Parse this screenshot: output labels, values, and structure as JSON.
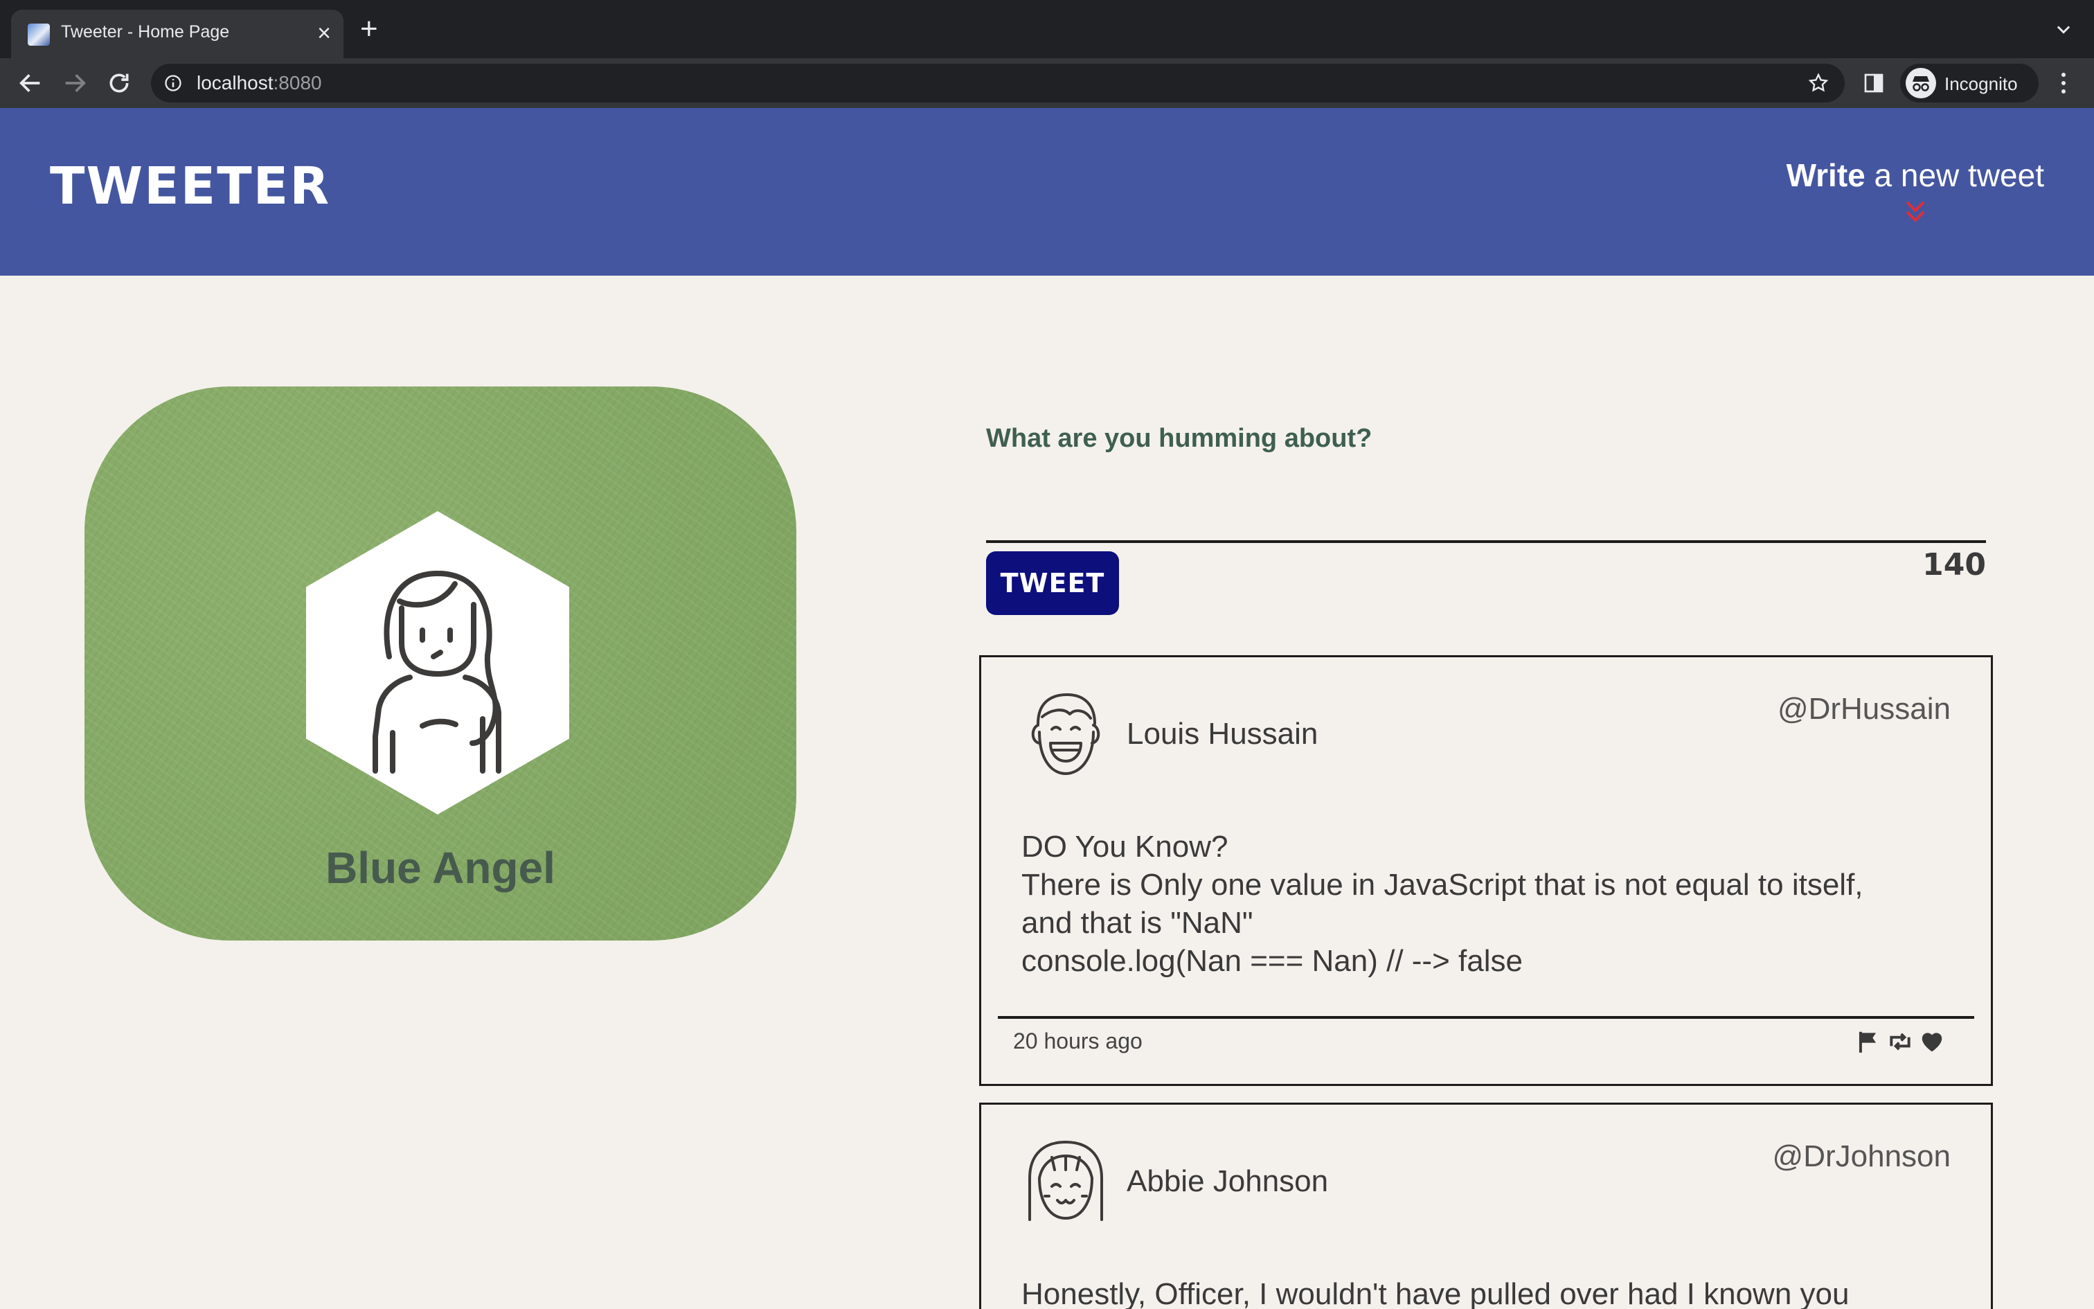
{
  "browser": {
    "tab_title": "Tweeter - Home Page",
    "url_host": "localhost",
    "url_port": ":8080",
    "profile_label": "Incognito"
  },
  "nav": {
    "logo": "TWEETER",
    "compose_strong": "Write",
    "compose_rest": " a new tweet",
    "accent": "#4556a0"
  },
  "profile": {
    "name": "Blue Angel",
    "avatar_icon": "girl-avatar-icon",
    "card_color": "#84a965"
  },
  "composer": {
    "prompt": "What are you humming about?",
    "input_value": "",
    "button_label": "TWEET",
    "char_count": "140",
    "button_color": "#0d0f7d"
  },
  "tweets": [
    {
      "name": "Louis Hussain",
      "handle": "@DrHussain",
      "avatar_icon": "smiling-boy-avatar-icon",
      "lines": [
        "DO You Know?",
        "There is Only one value in JavaScript that is not equal to itself,",
        "and that is \"NaN\"",
        "console.log(Nan === Nan) // --> false"
      ],
      "time": "20 hours ago"
    },
    {
      "name": "Abbie Johnson",
      "handle": "@DrJohnson",
      "avatar_icon": "girl-bangs-avatar-icon",
      "lines": [
        "Honestly, Officer, I wouldn't have pulled over had I known you were"
      ]
    }
  ]
}
